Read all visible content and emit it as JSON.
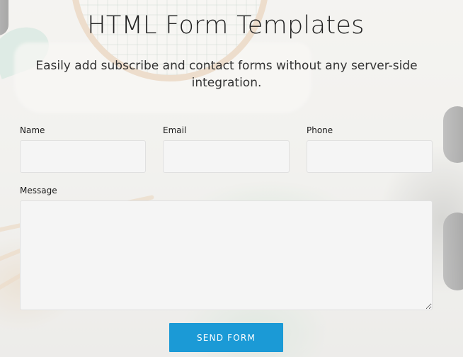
{
  "page": {
    "title": "HTML Form Templates",
    "subtitle": "Easily add subscribe and contact forms without any server-side integration."
  },
  "form": {
    "name_label": "Name",
    "name_value": "",
    "email_label": "Email",
    "email_value": "",
    "phone_label": "Phone",
    "phone_value": "",
    "message_label": "Message",
    "message_value": "",
    "submit_label": "SEND FORM"
  },
  "colors": {
    "accent": "#1b9ad6",
    "field_background": "#f5f5f5"
  }
}
